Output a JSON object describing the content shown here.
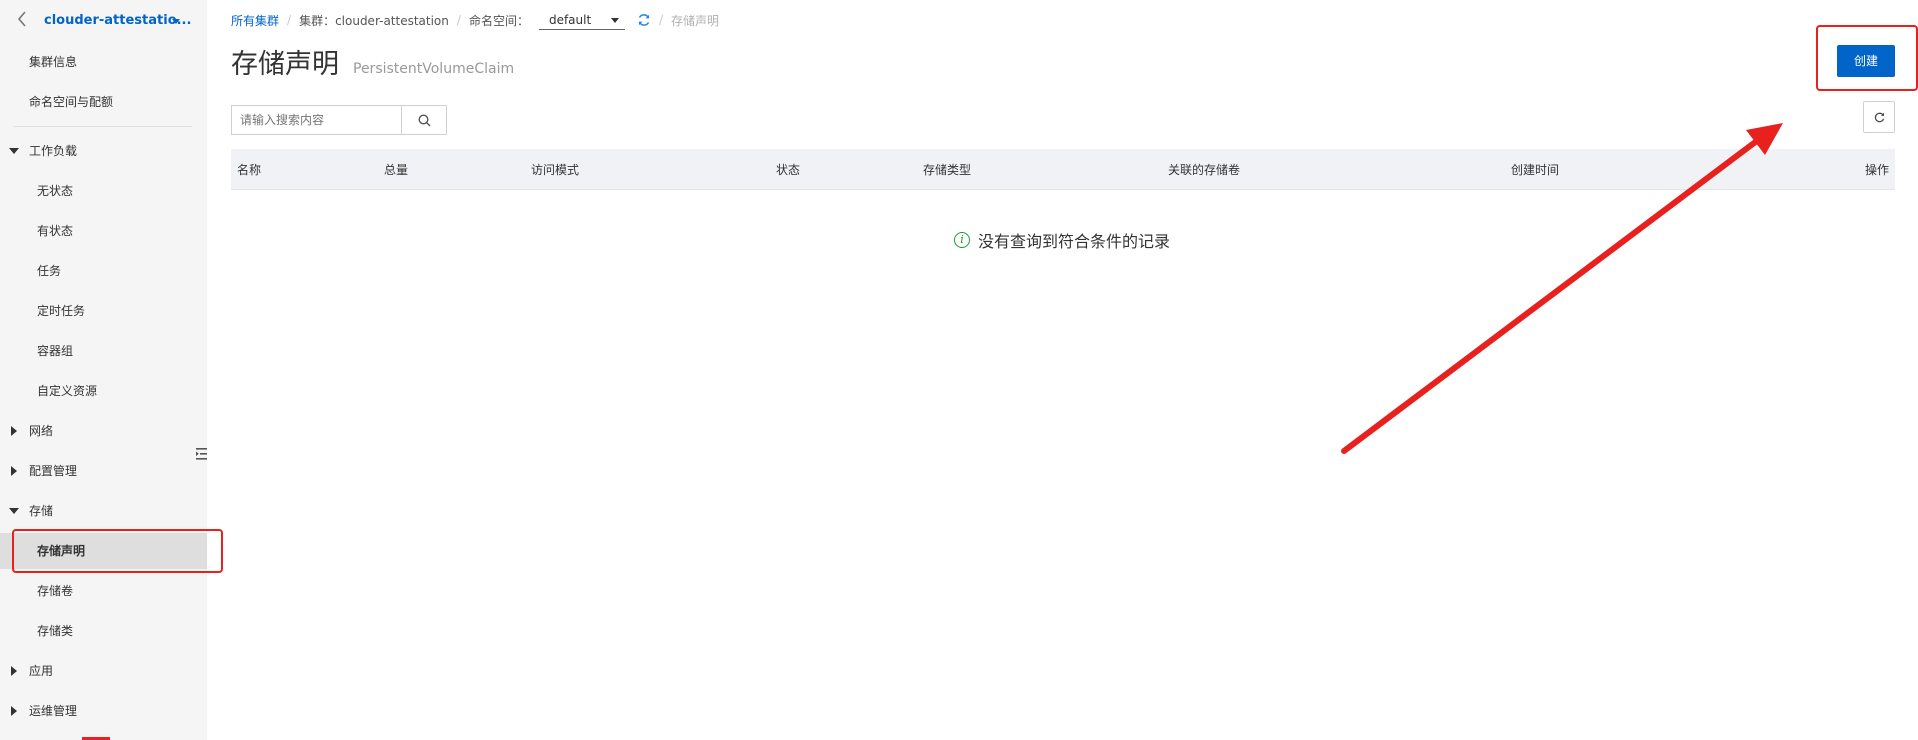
{
  "sidebar": {
    "cluster_name": "clouder-attestatio...",
    "items": {
      "cluster_info": "集群信息",
      "namespace_quota": "命名空间与配额",
      "workload": "工作负载",
      "stateless": "无状态",
      "stateful": "有状态",
      "job": "任务",
      "cronjob": "定时任务",
      "pod": "容器组",
      "custom_resource": "自定义资源",
      "network": "网络",
      "config": "配置管理",
      "storage": "存储",
      "pvc": "存储声明",
      "pv": "存储卷",
      "storage_class": "存储类",
      "apps": "应用",
      "ops": "运维管理"
    }
  },
  "breadcrumb": {
    "all_clusters": "所有集群",
    "cluster_label": "集群：clouder-attestation",
    "namespace_label": "命名空间：",
    "namespace_value": "default",
    "current": "存储声明"
  },
  "page": {
    "title": "存储声明",
    "subtitle": "PersistentVolumeClaim",
    "create_label": "创建",
    "search_placeholder": "请输入搜索内容"
  },
  "table": {
    "columns": [
      "名称",
      "总量",
      "访问模式",
      "状态",
      "存储类型",
      "关联的存储卷",
      "创建时间",
      "操作"
    ],
    "empty_text": "没有查询到符合条件的记录"
  },
  "colors": {
    "accent": "#0064c8",
    "annotation": "#e8201e",
    "success": "#1a9b2f"
  }
}
